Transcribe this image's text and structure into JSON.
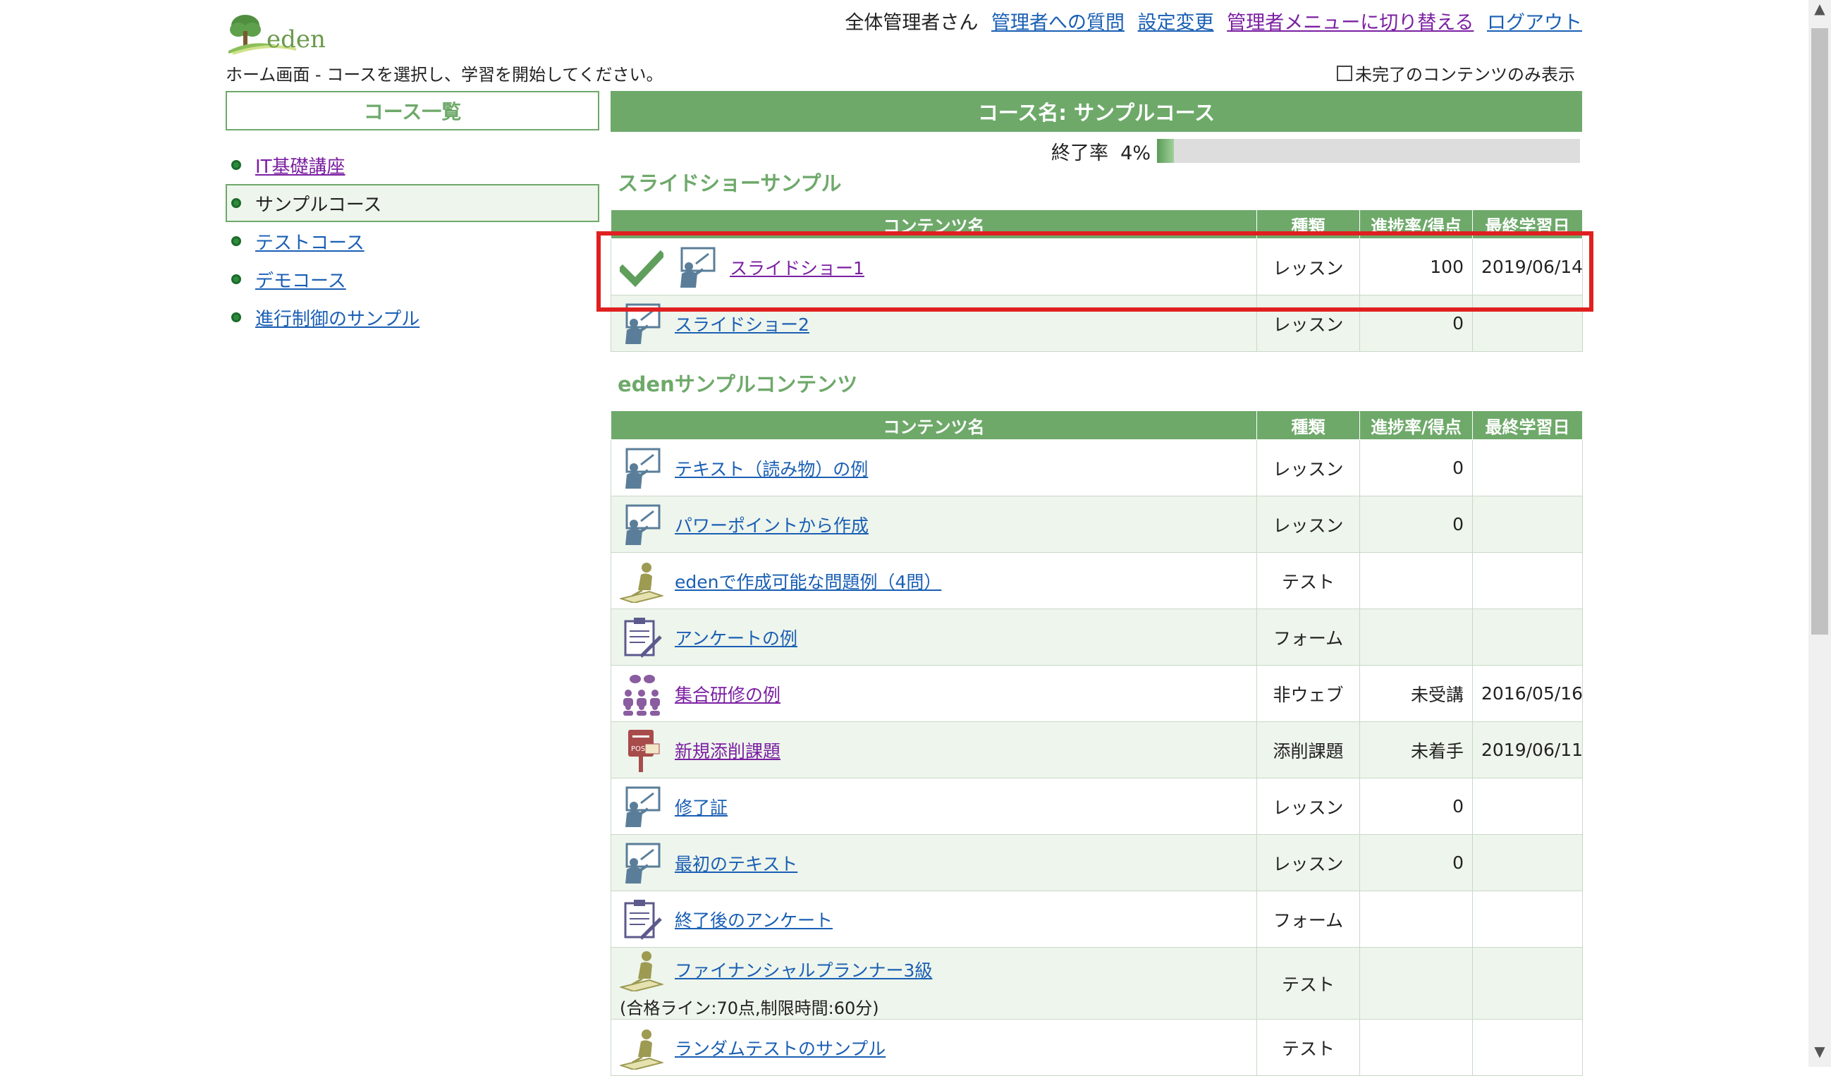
{
  "header": {
    "logo_text": "eden",
    "user": "全体管理者さん",
    "links": [
      "管理者への質問",
      "設定変更",
      "管理者メニューに切り替える",
      "ログアウト"
    ],
    "subtitle": "ホーム画面 - コースを選択し、学習を開始してください。",
    "filter_label": "未完了のコンテンツのみ表示"
  },
  "sidebar": {
    "title": "コース一覧",
    "courses": [
      "IT基礎講座",
      "サンプルコース",
      "テストコース",
      "デモコース",
      "進行制御のサンプル"
    ],
    "active_index": 1
  },
  "course": {
    "title": "コース名: サンプルコース",
    "progress_label": "終了率",
    "progress_value": "4%",
    "progress_fraction": 0.04
  },
  "columns": [
    "コンテンツ名",
    "種類",
    "進捗率/得点",
    "最終学習日"
  ],
  "sections": [
    {
      "title": "スライドショーサンプル",
      "rows": [
        {
          "name": "スライドショー1",
          "kind": "レッスン",
          "score": "100",
          "date": "2019/06/14",
          "icon": "lesson-board-icon",
          "done": true
        },
        {
          "name": "スライドショー2",
          "kind": "レッスン",
          "score": "0",
          "date": "",
          "icon": "lesson-board-icon",
          "done": false
        }
      ]
    },
    {
      "title": "edenサンプルコンテンツ",
      "rows": [
        {
          "name": "テキスト（読み物）の例",
          "kind": "レッスン",
          "score": "0",
          "date": "",
          "icon": "lesson-board-icon"
        },
        {
          "name": "パワーポイントから作成",
          "kind": "レッスン",
          "score": "0",
          "date": "",
          "icon": "lesson-board-icon"
        },
        {
          "name": "edenで作成可能な問題例（4問）",
          "kind": "テスト",
          "score": "",
          "date": "",
          "icon": "test-writing-icon"
        },
        {
          "name": "アンケートの例",
          "kind": "フォーム",
          "score": "",
          "date": "",
          "icon": "clipboard-form-icon"
        },
        {
          "name": "集合研修の例",
          "kind": "非ウェブ",
          "score": "未受講",
          "date": "2016/05/16",
          "icon": "group-training-icon"
        },
        {
          "name": "新規添削課題",
          "kind": "添削課題",
          "score": "未着手",
          "date": "2019/06/11",
          "icon": "post-box-icon"
        },
        {
          "name": "修了証",
          "kind": "レッスン",
          "score": "0",
          "date": "",
          "icon": "lesson-board-icon"
        },
        {
          "name": "最初のテキスト",
          "kind": "レッスン",
          "score": "0",
          "date": "",
          "icon": "lesson-board-icon"
        },
        {
          "name": "終了後のアンケート",
          "kind": "フォーム",
          "score": "",
          "date": "",
          "icon": "clipboard-form-icon"
        },
        {
          "name": "ファイナンシャルプランナー3級",
          "note": "(合格ライン:70点,制限時間:60分)",
          "kind": "テスト",
          "score": "",
          "date": "",
          "icon": "test-writing-icon"
        },
        {
          "name": "ランダムテストのサンプル",
          "kind": "テスト",
          "score": "",
          "date": "",
          "icon": "test-writing-icon"
        }
      ]
    }
  ],
  "colors": {
    "accent": "#6ea96a",
    "link": "#1a5fb4",
    "visited": "#7b1fa2",
    "highlight": "#e02020"
  }
}
